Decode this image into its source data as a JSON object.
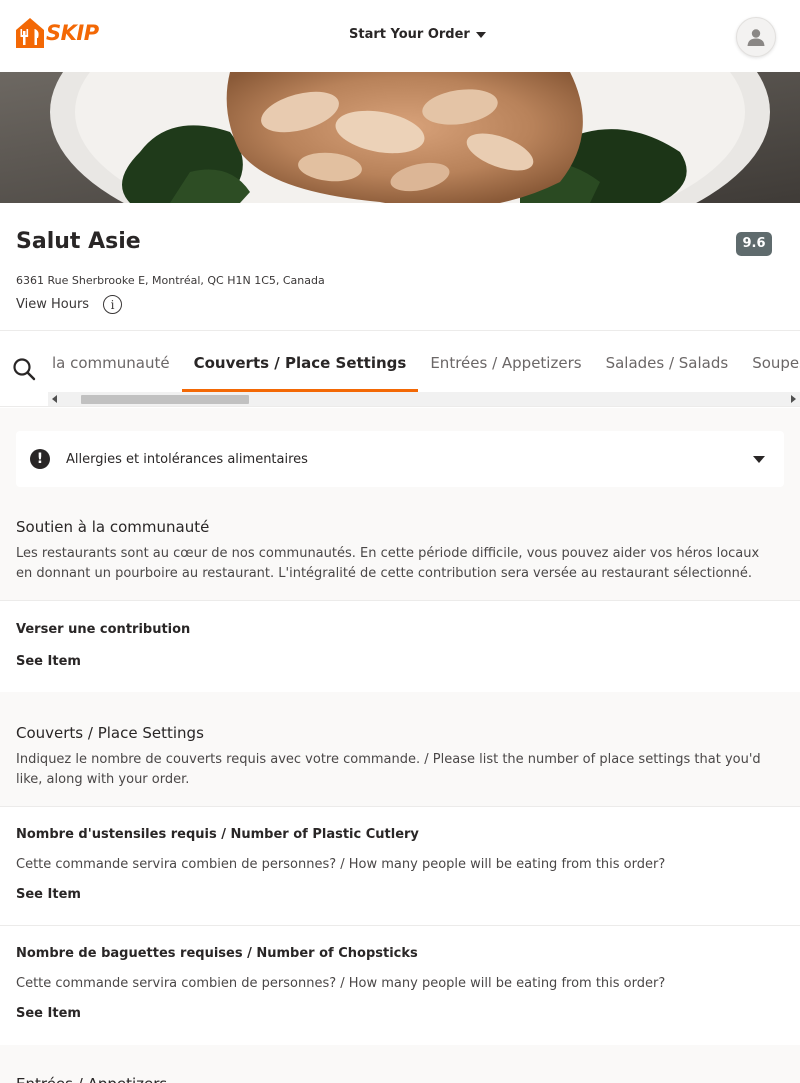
{
  "header": {
    "logo_text": "SKIP",
    "start_order_label": "Start Your Order"
  },
  "restaurant": {
    "name": "Salut Asie",
    "rating": "9.6",
    "address": "6361 Rue Sherbrooke E, Montréal, QC H1N 1C5, Canada",
    "view_hours_label": "View Hours"
  },
  "nav": {
    "tabs": [
      {
        "label": "la communauté"
      },
      {
        "label": "Couverts / Place Settings"
      },
      {
        "label": "Entrées / Appetizers"
      },
      {
        "label": "Salades / Salads"
      },
      {
        "label": "Soupes Tonkin"
      }
    ]
  },
  "allergy": {
    "label": "Allergies et intolérances alimentaires"
  },
  "sections": [
    {
      "title": "Soutien à la communauté",
      "description": "Les restaurants sont au cœur de nos communautés. En cette période difficile, vous pouvez aider vos héros locaux en donnant un pourboire au restaurant. L'intégralité de cette contribution sera versée au restaurant sélectionné.",
      "items": [
        {
          "name": "Verser une contribution",
          "see_item": "See Item"
        }
      ]
    },
    {
      "title": "Couverts / Place Settings",
      "description": "Indiquez le nombre de couverts requis avec votre commande. / Please list the number of place settings that you'd like, along with your order.",
      "items": [
        {
          "name": "Nombre d'ustensiles requis / Number of Plastic Cutlery",
          "description": "Cette commande servira combien de personnes? / How many people will be eating from this order?",
          "see_item": "See Item"
        },
        {
          "name": "Nombre de baguettes requises / Number of Chopsticks",
          "description": "Cette commande servira combien de personnes? / How many people will be eating from this order?",
          "see_item": "See Item"
        }
      ]
    },
    {
      "title": "Entrées / Appetizers"
    }
  ],
  "colors": {
    "brand": "#f36805",
    "text": "#292626",
    "rating_bg": "#5f6b6d"
  }
}
